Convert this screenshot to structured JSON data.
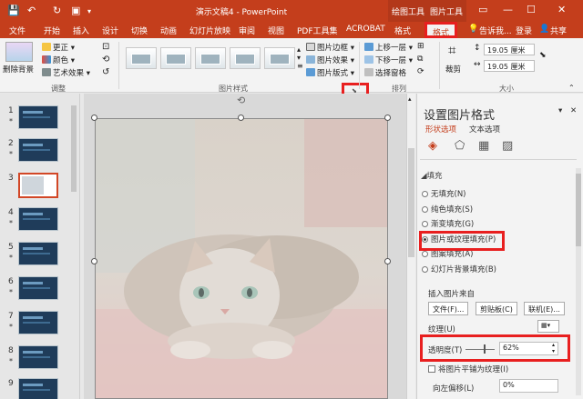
{
  "window": {
    "title": "演示文稿4 - PowerPoint",
    "context_tabs": [
      "绘图工具",
      "图片工具"
    ],
    "controls": [
      "▭",
      "—",
      "☐",
      "✕"
    ]
  },
  "tabs": {
    "items": [
      "文件",
      "开始",
      "插入",
      "设计",
      "切换",
      "动画",
      "幻灯片放映",
      "审阅",
      "视图",
      "PDF工具集",
      "ACROBAT",
      "格式",
      "格式"
    ],
    "active_index": 12,
    "tell_me": "告诉我...",
    "login": "登录",
    "share": "共享"
  },
  "ribbon": {
    "adjust": {
      "remove_bg": "删除背景",
      "corrections": "更正",
      "color": "颜色",
      "artistic": "艺术效果",
      "label": "调整"
    },
    "styles": {
      "label": "图片样式",
      "border": "图片边框",
      "effects": "图片效果",
      "layout": "图片版式"
    },
    "arrange": {
      "bring_forward": "上移一层",
      "send_backward": "下移一层",
      "selection_pane": "选择窗格",
      "label": "排列"
    },
    "size": {
      "crop": "裁剪",
      "height": "19.05 厘米",
      "width": "19.05 厘米",
      "label": "大小"
    }
  },
  "slides": {
    "numbers": [
      "1",
      "2",
      "3",
      "4",
      "5",
      "6",
      "7",
      "8",
      "9"
    ],
    "star": "*",
    "selected_index": 2
  },
  "pane": {
    "title": "设置图片格式",
    "subtabs": [
      "形状选项",
      "文本选项"
    ],
    "section": "填充",
    "options": [
      "无填充(N)",
      "纯色填充(S)",
      "渐变填充(G)",
      "图片或纹理填充(P)",
      "图案填充(A)",
      "幻灯片背景填充(B)"
    ],
    "selected_option": 3,
    "insert_from": "插入图片来自",
    "buttons": [
      "文件(F)...",
      "剪贴板(C)",
      "联机(E)..."
    ],
    "texture_label": "纹理(U)",
    "transparency_label": "透明度(T)",
    "transparency_value": "62%",
    "tile_label": "将图片平铺为纹理(I)",
    "offset_label": "向左偏移(L)",
    "offset_value": "0%",
    "close": "✕",
    "pin": "▾"
  },
  "colors": {
    "accent": "#c43e1c",
    "highlight": "#e81f1f"
  }
}
